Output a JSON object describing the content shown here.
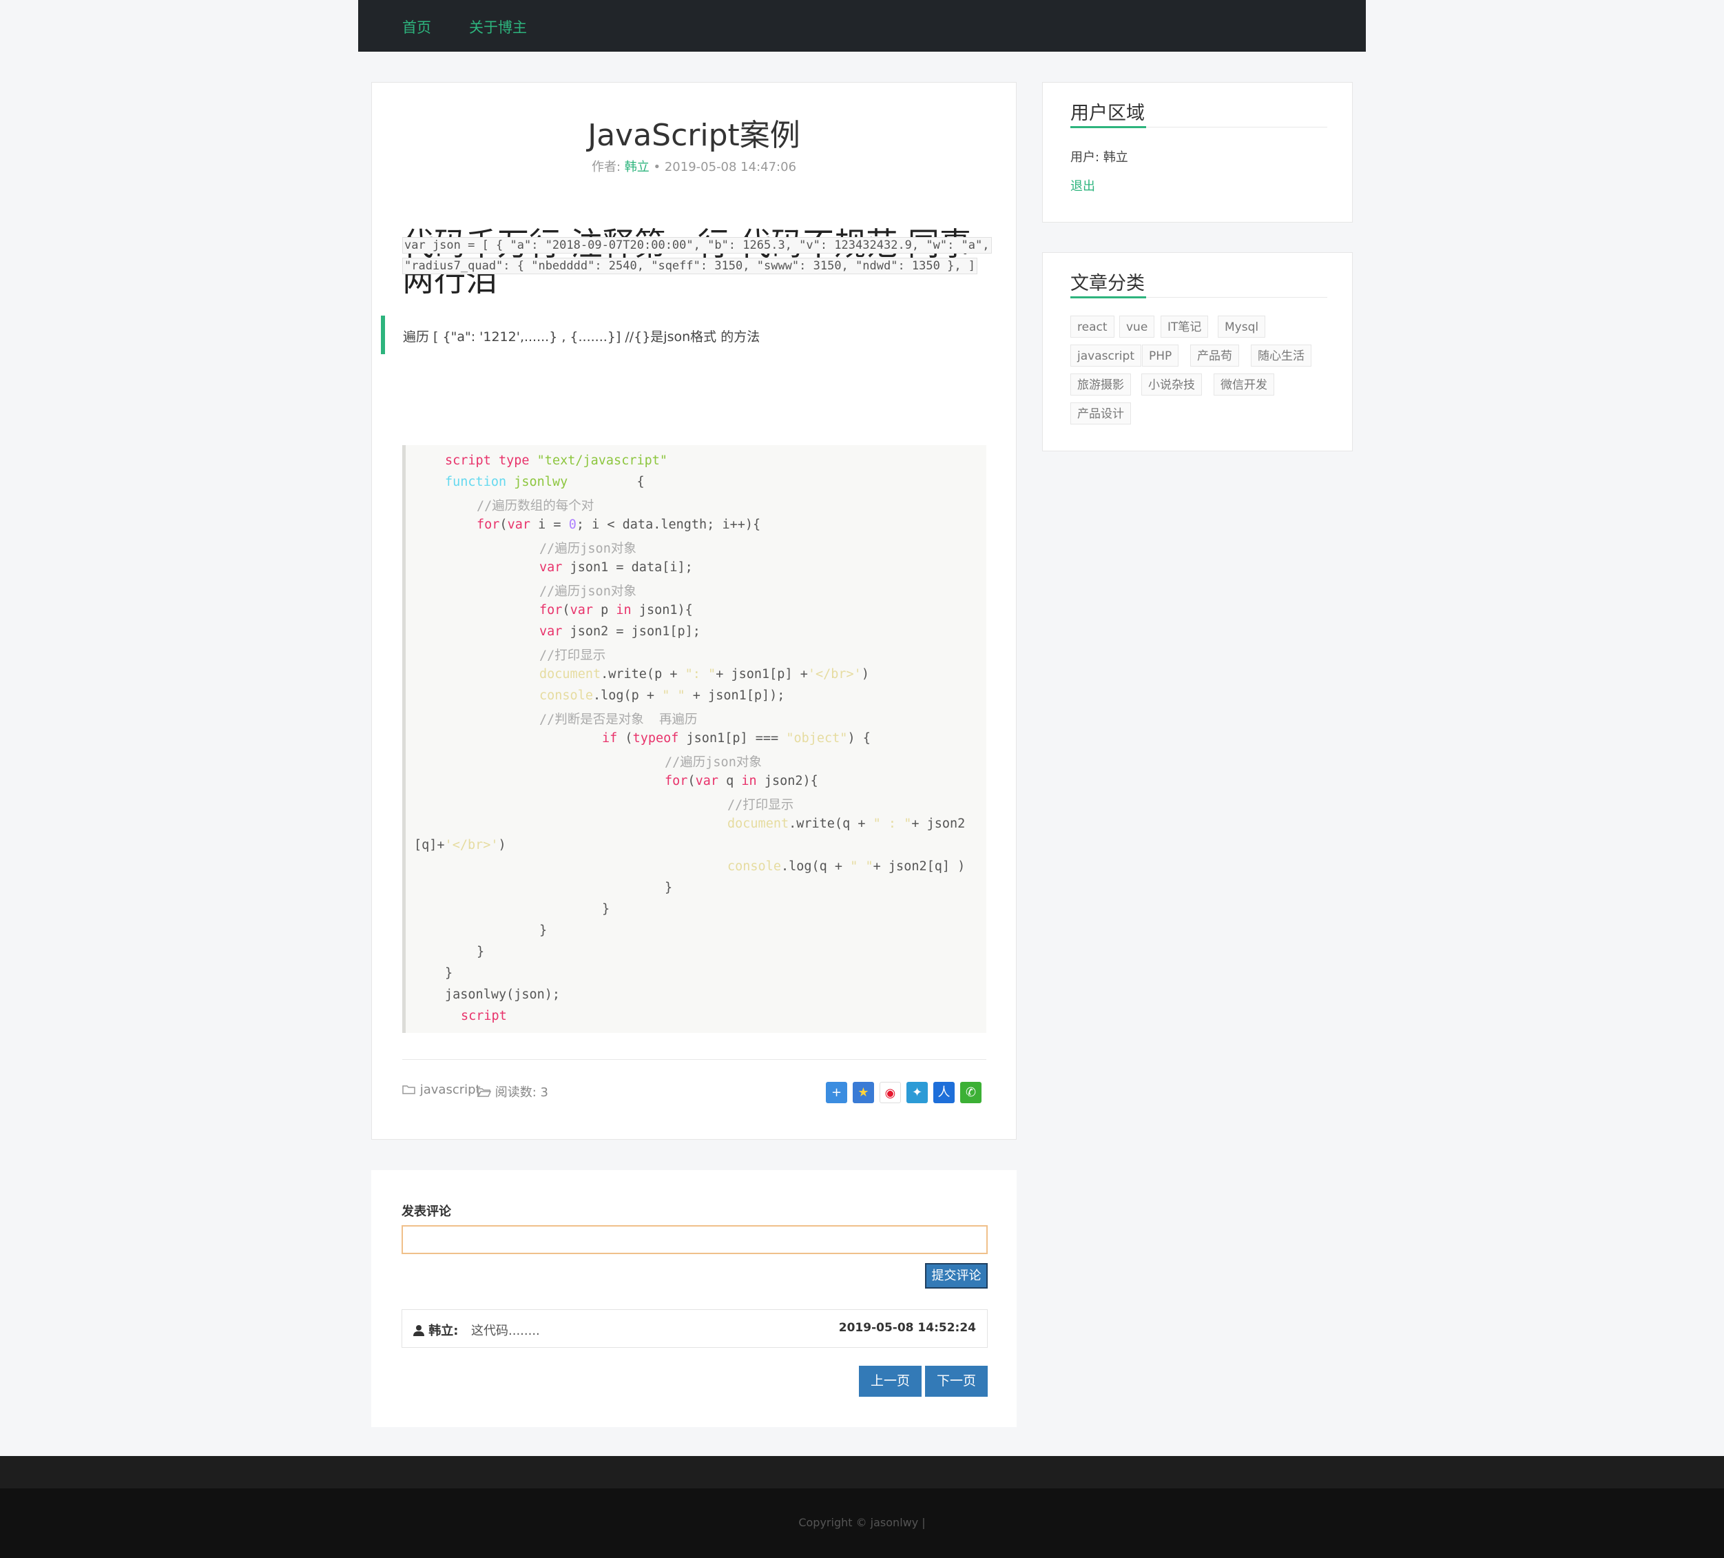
{
  "nav": {
    "home": "首页",
    "about": "关于博主"
  },
  "article": {
    "title": "JavaScript案例",
    "author_label": "作者:",
    "author": "韩立",
    "date": "• 2019-05-08 14:47:06",
    "heading": "代码千万行 注释第一行 代码不规范 同事两行泪",
    "quote": "遍历 [ {\"a\": '1212',......} , {.......}] //{}是json格式 的方法",
    "json_line1": "var json = [ { \"a\": \"2018-09-07T20:00:00\", \"b\": 1265.3, \"v\": 123432432.9, \"w\": \"a\",",
    "json_line2": "\"radius7_quad\": { \"nbedddd\": 2540, \"sqeff\": 3150, \"swww\": 3150, \"ndwd\": 1350 }, ]",
    "category": "javascript",
    "reads": "阅读数: 3"
  },
  "code": {
    "script_kw": "script",
    "type_kw": "type",
    "type_val": "\"text/javascript\"",
    "function_kw": "function",
    "fn_name": "jsonlwy",
    "brace_open": "{",
    "c1": "//遍历数组的每个对",
    "for_kw": "for",
    "var_kw": "var",
    "l_for1_a": "(",
    "l_for1_b": " i = ",
    "zero": "0",
    "l_for1_c": "; i < data.length; i++){",
    "c2": "//遍历json对象",
    "l_json1": " json1 = data[i];",
    "c3": "//遍历json对象",
    "l_p": " p ",
    "in_kw": "in",
    "l_json1b": " json1){",
    "l_json2": " json2 = json1[p];",
    "c4": "//打印显示",
    "document": "document",
    "l_write1_a": ".write(p + ",
    "q_colon": "\": \"",
    "l_write1_b": "+ json1[p] +",
    "br_tag": "'</br>'",
    "close_paren": ")",
    "console": "console",
    "l_log1_a": ".log(p + ",
    "q_space": "\" \"",
    "l_log1_b": " + json1[p]);",
    "c5": "//判断是否是对象  再遍历",
    "if_kw": "if",
    "typeof_kw": "typeof",
    "l_if_a": " (",
    "l_if_b": " json1[p] === ",
    "obj_str": "\"object\"",
    "l_if_c": ") {",
    "c6": "//遍历json对象",
    "l_q": " q ",
    "l_json2b": " json2){",
    "c7": "//打印显示",
    "l_write2_a": ".write(q + ",
    "q_colon2": "\" : \"",
    "l_write2_b": "+ json2",
    "l_write2_c": "[q]+",
    "l_log2_a": ".log(q + ",
    "q_space2": "\" \"",
    "l_log2_b": "+ json2[q] )",
    "brace_close": "}",
    "call": "jasonlwy(json);"
  },
  "comments": {
    "label": "发表评论",
    "submit": "提交评论",
    "items": [
      {
        "user": "韩立:",
        "text": "这代码........",
        "time": "2019-05-08 14:52:24"
      }
    ],
    "prev": "上一页",
    "next": "下一页"
  },
  "sidebar": {
    "user_title": "用户区域",
    "user_line": "用户: 韩立",
    "logout": "退出",
    "cat_title": "文章分类",
    "tags": [
      "react",
      "vue",
      "IT笔记",
      "Mysql",
      "javascript",
      "PHP",
      "产品苟",
      "随心生活",
      "旅游摄影",
      "小说杂技",
      "微信开发",
      "产品设计"
    ]
  },
  "share_icons": [
    "plus-share-icon",
    "star-share-icon",
    "weibo-share-icon",
    "qzone-share-icon",
    "renren-share-icon",
    "wechat-share-icon"
  ],
  "colors": {
    "accent": "#2db47d",
    "button": "#337ab7",
    "nav_bg": "#212529"
  },
  "footer": {
    "copyright": "Copyright © jasonlwy    |"
  }
}
